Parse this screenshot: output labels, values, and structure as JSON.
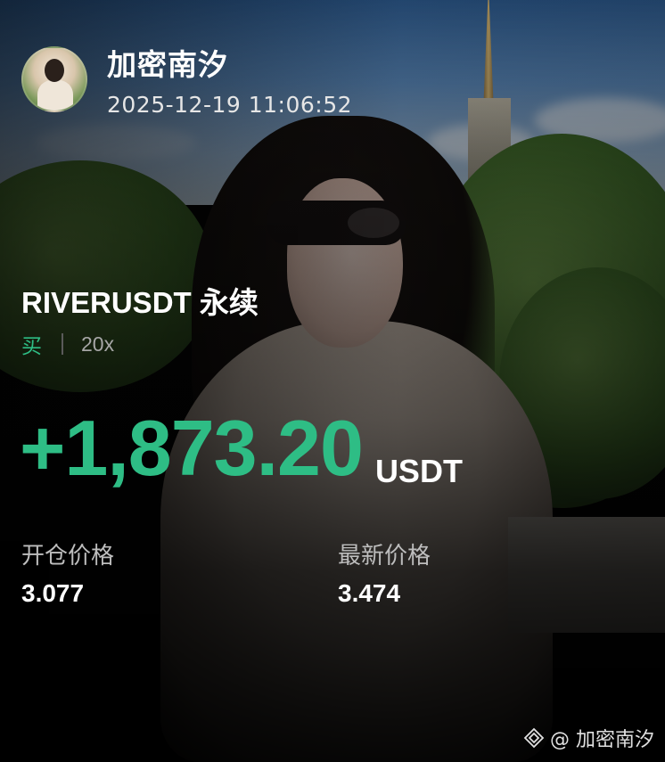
{
  "user": {
    "name": "加密南汐",
    "timestamp": "2025-12-19 11:06:52"
  },
  "trade": {
    "symbol": "RIVERUSDT 永续",
    "side": "买",
    "leverage": "20x",
    "pnl": "+1,873.20",
    "pnl_unit": "USDT",
    "entry_price_label": "开仓价格",
    "entry_price": "3.077",
    "last_price_label": "最新价格",
    "last_price": "3.474"
  },
  "watermark": {
    "text": "@ 加密南汐",
    "icon": "binance-square-icon"
  },
  "colors": {
    "profit_green": "#2ebd85",
    "background": "#000000"
  }
}
